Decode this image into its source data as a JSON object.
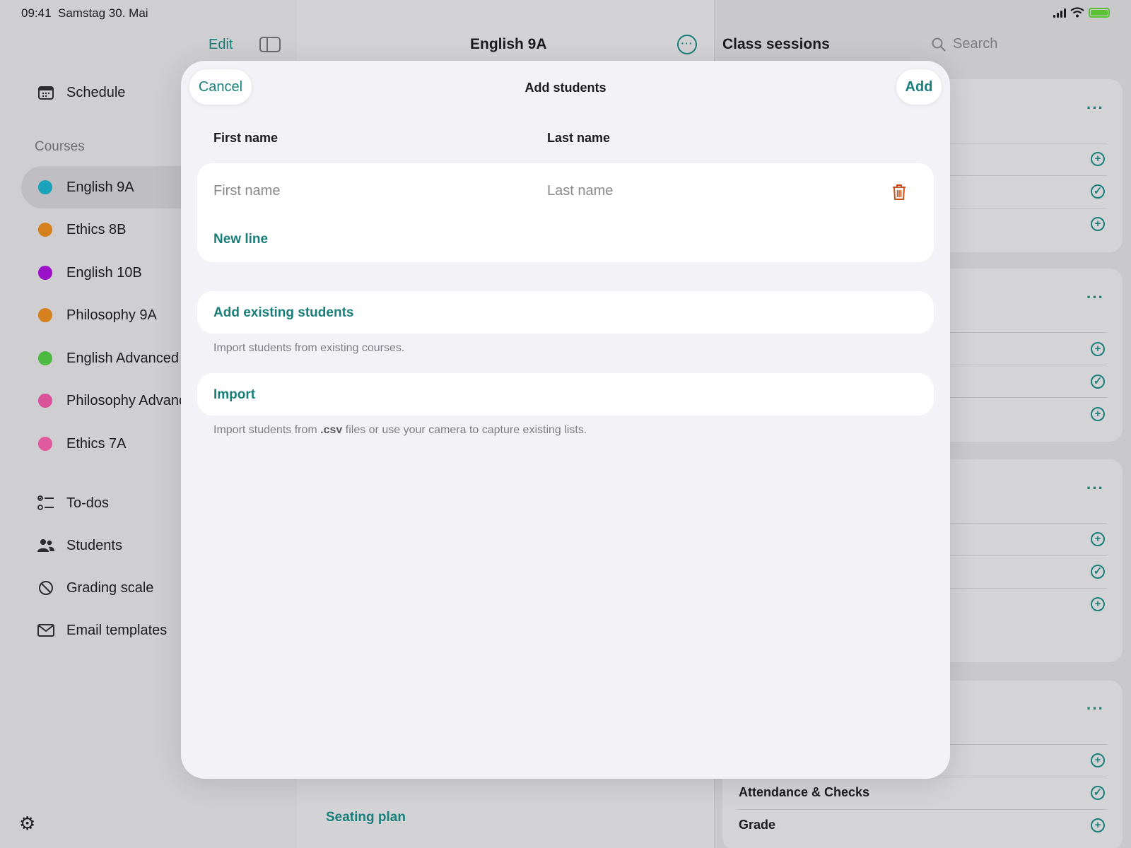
{
  "status": {
    "time": "09:41",
    "date": "Samstag 30. Mai"
  },
  "sidebar": {
    "edit_label": "Edit",
    "schedule_label": "Schedule",
    "courses_label": "Courses",
    "courses": [
      {
        "label": "English 9A",
        "color": "#1aa3b8"
      },
      {
        "label": "Ethics 8B",
        "color": "#d4801c"
      },
      {
        "label": "English 10B",
        "color": "#9b12c8"
      },
      {
        "label": "Philosophy 9A",
        "color": "#d4801c"
      },
      {
        "label": "English Advanced",
        "color": "#4cb940"
      },
      {
        "label": "Philosophy Advanc",
        "color": "#d9529a"
      },
      {
        "label": "Ethics 7A",
        "color": "#e05aa0"
      }
    ],
    "todos_label": "To-dos",
    "students_label": "Students",
    "grading_label": "Grading scale",
    "email_label": "Email templates"
  },
  "detail": {
    "title": "English 9A",
    "seating_label": "Seating plan"
  },
  "rightpane": {
    "title": "Class sessions",
    "search_placeholder": "Search",
    "attendance_label": "Attendance & Checks",
    "grade_label": "Grade"
  },
  "modal": {
    "title": "Add students",
    "cancel_label": "Cancel",
    "add_label": "Add",
    "first_name_header": "First name",
    "last_name_header": "Last name",
    "first_name_placeholder": "First name",
    "last_name_placeholder": "Last name",
    "first_name_value": "",
    "last_name_value": "",
    "new_line_label": "New line",
    "add_existing_label": "Add existing students",
    "add_existing_note": "Import students from existing courses.",
    "import_label": "Import",
    "import_note_before": "Import students from ",
    "import_note_bold": ".csv",
    "import_note_after": " files or use your camera to capture existing lists."
  },
  "colors": {
    "accent": "#1a7f7a",
    "destructive": "#c8521e"
  }
}
